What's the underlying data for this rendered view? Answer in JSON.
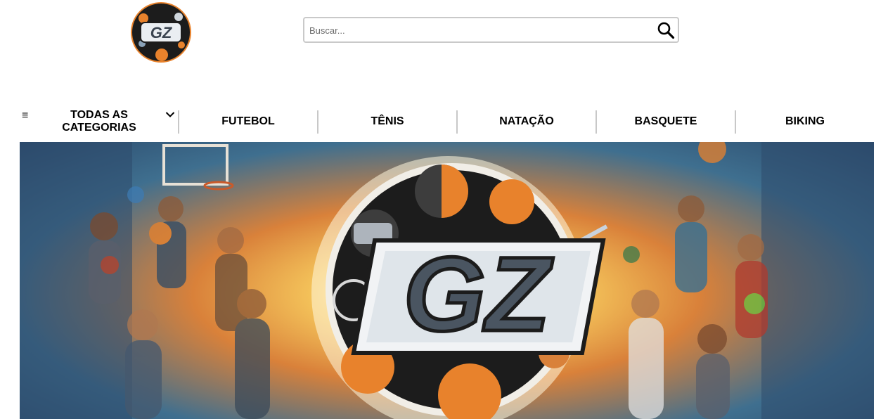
{
  "header": {
    "logo_text": "GZ",
    "search": {
      "placeholder": "Buscar...",
      "value": ""
    }
  },
  "nav": {
    "all_categories_label": "TODAS AS CATEGORIAS",
    "items": [
      {
        "label": "FUTEBOL"
      },
      {
        "label": "TÊNIS"
      },
      {
        "label": "NATAÇÃO"
      },
      {
        "label": "BASQUETE"
      },
      {
        "label": "BIKING"
      }
    ]
  },
  "banner": {
    "logo_text": "GZ"
  },
  "colors": {
    "accent_orange": "#e8822c",
    "banner_navy": "#2b4a6c",
    "logo_dark": "#1c1c1c",
    "logo_silver": "#c9d2dc"
  }
}
